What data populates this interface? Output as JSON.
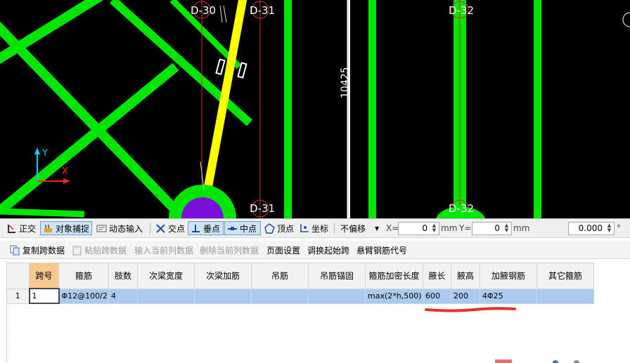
{
  "canvas": {
    "axis_labels": [
      "D-30",
      "D-31",
      "D-32",
      "D-31",
      "D-32"
    ],
    "dimension": "10425",
    "ucs": {
      "x": "X",
      "y": "Y"
    }
  },
  "snap_toolbar": {
    "orthogonal": "正交",
    "object_snap": "对象捕捉",
    "dynamic_input": "动态输入",
    "intersection": "交点",
    "perpendicular": "垂点",
    "midpoint": "中点",
    "vertex": "顶点",
    "coordinate": "坐标",
    "offset_mode": "不偏移",
    "x_label": "X=",
    "x_value": "0",
    "y_label": "Y=",
    "y_value": "0",
    "unit": "mm",
    "angle_value": "0.000",
    "angle_unit": "°"
  },
  "action_bar": {
    "copy_span": "复制跨数据",
    "paste_span": "粘贴跨数据",
    "input_column": "输入当前列数据",
    "delete_column": "删除当前列数据",
    "page_setup": "页面设置",
    "adjust_start": "调换起始跨",
    "cantilever_code": "悬臂钢筋代号"
  },
  "table": {
    "headers": [
      "跨号",
      "箍筋",
      "肢数",
      "次梁宽度",
      "次梁加筋",
      "吊筋",
      "吊筋锚固",
      "箍筋加密长度",
      "腋长",
      "腋高",
      "加腋钢筋",
      "其它箍筋"
    ],
    "rows": [
      {
        "row_no": "1",
        "cells": [
          "1",
          "Φ12@100/2",
          "4",
          "",
          "",
          "",
          "",
          "max(2*h,500)",
          "600",
          "200",
          "4Φ25",
          ""
        ]
      }
    ]
  },
  "colors": {
    "canvas_bg": "#000000",
    "beam_green": "#00e600",
    "beam_yellow": "#ffff00",
    "selection_row": "#a8cbef",
    "header_highlight": "#f7c98e",
    "annotation_red": "#e8302a"
  }
}
